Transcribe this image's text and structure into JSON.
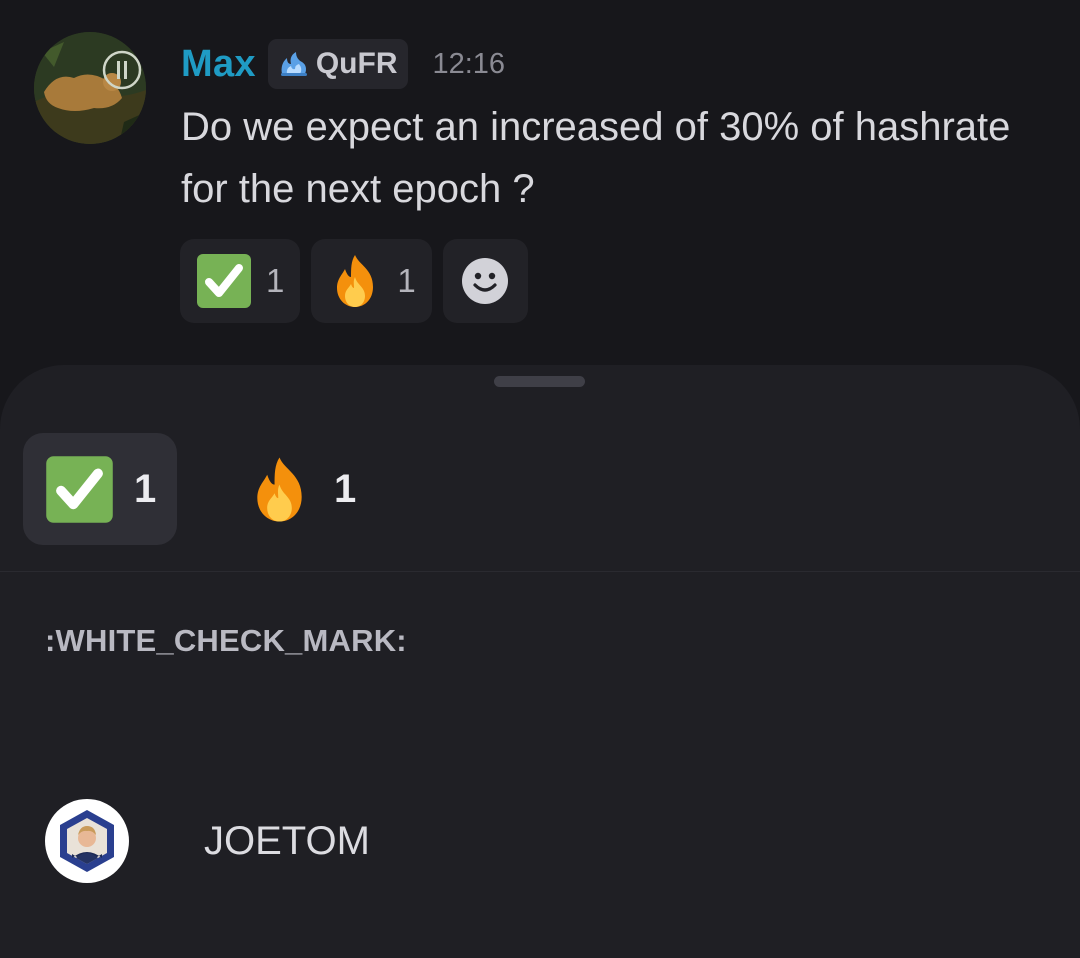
{
  "message": {
    "avatar_icon": "cougar-avatar-icon",
    "username": "Max",
    "username_color": "#1f9bc4",
    "tag": {
      "icon": "blue-flame-icon",
      "label": "QuFR"
    },
    "timestamp": "12:16",
    "body": "Do we expect an increased of 30% of hashrate for the next epoch ?",
    "reactions": [
      {
        "emoji": "white-check-mark-icon",
        "count": "1"
      },
      {
        "emoji": "fire-icon",
        "count": "1"
      }
    ],
    "add_reaction_icon": "add-reaction-smiley-icon"
  },
  "sheet": {
    "tabs": [
      {
        "emoji": "white-check-mark-icon",
        "count": "1",
        "selected": true
      },
      {
        "emoji": "fire-icon",
        "count": "1",
        "selected": false
      }
    ],
    "section_label": ":WHITE_CHECK_MARK:",
    "users": [
      {
        "avatar_icon": "user-hexagon-avatar-icon",
        "name": "JOETOM"
      }
    ]
  },
  "colors": {
    "background": "#17171b",
    "sheet_background": "#1f1f24",
    "check_green": "#77b255",
    "accent_blue": "#1f9bc4"
  }
}
